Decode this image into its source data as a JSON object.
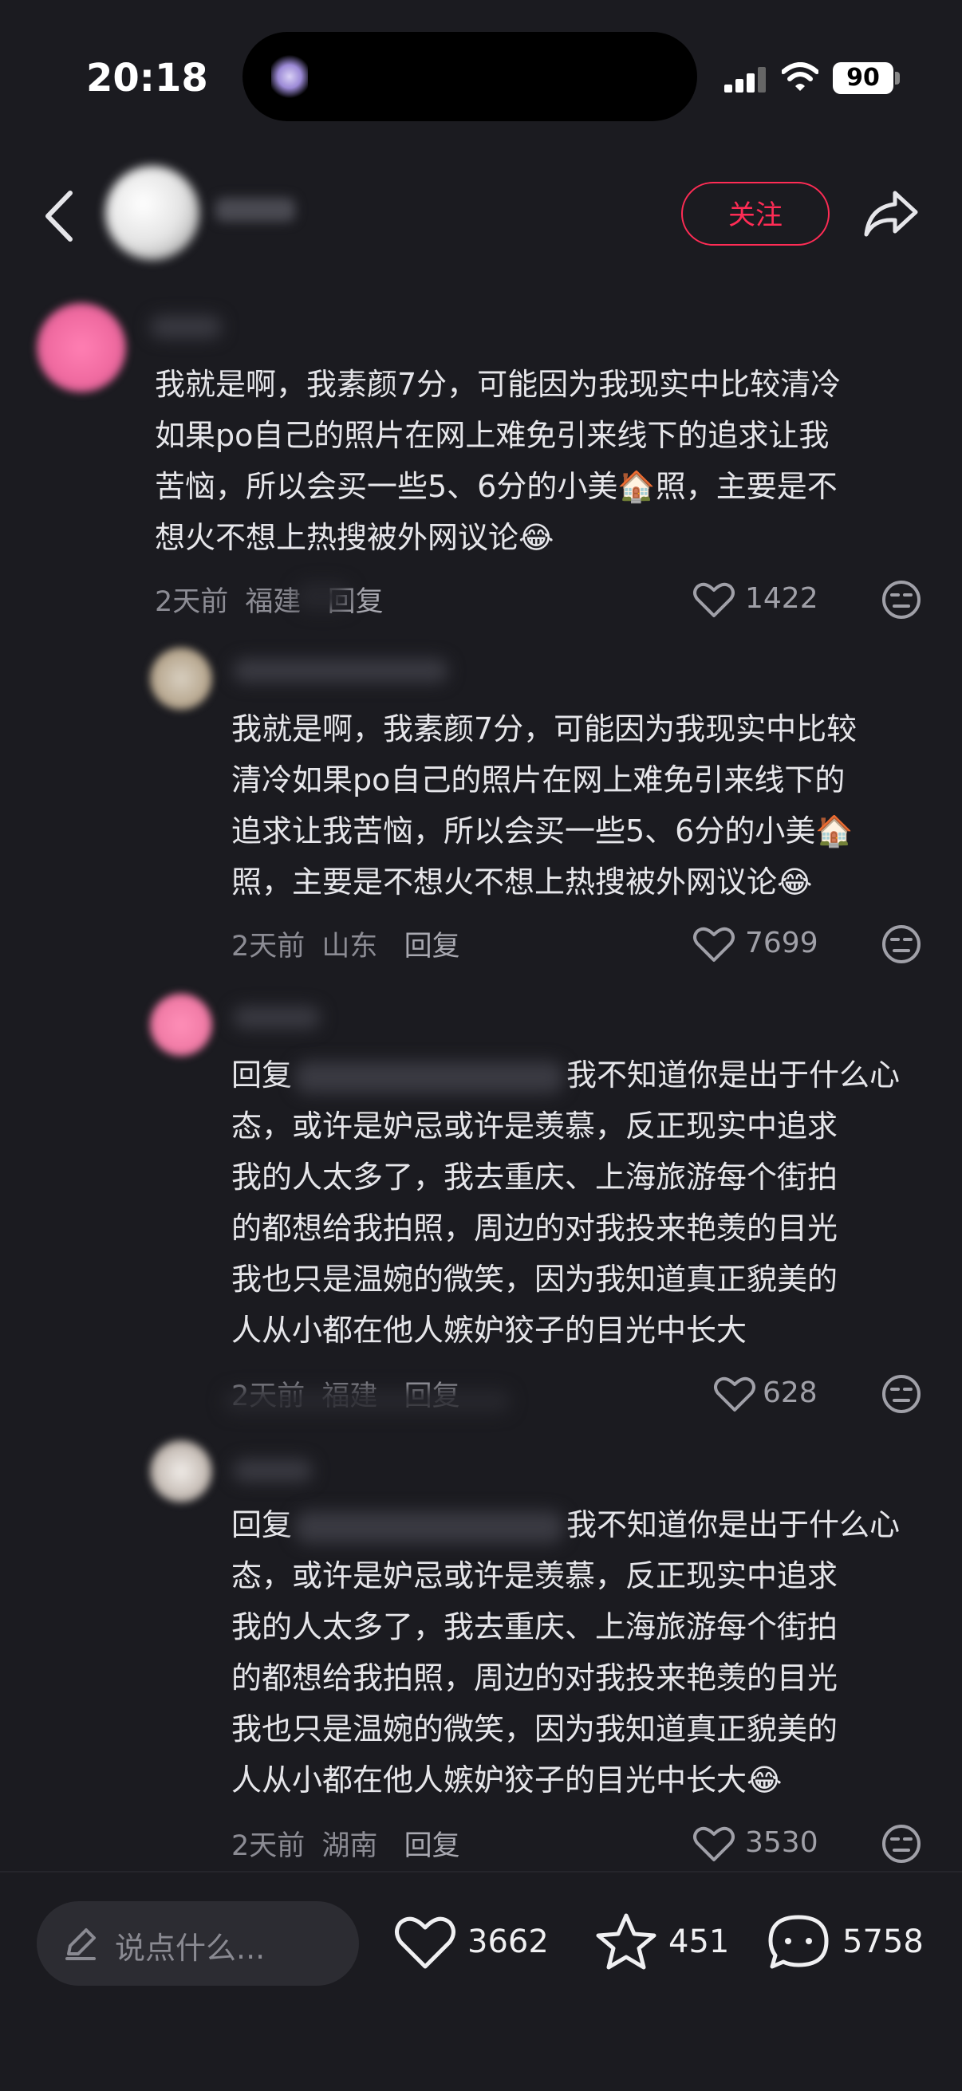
{
  "status": {
    "time": "20:18",
    "battery": "90"
  },
  "header": {
    "follow_label": "关注"
  },
  "comments": [
    {
      "text_a": "我就是啊，我素颜7分，可能因为我现实中比较清冷",
      "text_b": "如果po自己的照片在网上难免引来线下的追求让我",
      "text_c": "苦恼，所以会买一些5、6分的小美",
      "text_c2": "照，主要是不",
      "text_d": "想火不想上热搜被外网议论",
      "time": "2天前",
      "location": "福建",
      "reply_label": "回复",
      "likes": "1422"
    },
    {
      "text_a": "我就是啊，我素颜7分，可能因为我现实中比较",
      "text_b": "清冷如果po自己的照片在网上难免引来线下的",
      "text_c": "追求让我苦恼，所以会买一些5、6分的小美",
      "text_d": "照，主要是不想火不想上热搜被外网议论",
      "time": "2天前",
      "location": "山东",
      "reply_label": "回复",
      "likes": "7699"
    },
    {
      "reply_prefix": "回复",
      "text_a": "我不知道你是出于什么心",
      "text_b": "态，或许是妒忌或许是羡慕，反正现实中追求",
      "text_c": "我的人太多了，我去重庆、上海旅游每个街拍",
      "text_d": "的都想给我拍照，周边的对我投来艳羡的目光",
      "text_e": "我也只是温婉的微笑，因为我知道真正貌美的",
      "text_f": "人从小都在他人嫉妒狡子的目光中长大",
      "time": "2天前",
      "location": "福建",
      "reply_label": "回复",
      "likes": "628"
    },
    {
      "reply_prefix": "回复",
      "text_a": "我不知道你是出于什么心",
      "text_b": "态，或许是妒忌或许是羡慕，反正现实中追求",
      "text_c": "我的人太多了，我去重庆、上海旅游每个街拍",
      "text_d": "的都想给我拍照，周边的对我投来艳羡的目光",
      "text_e": "我也只是温婉的微笑，因为我知道真正貌美的",
      "text_f": "人从小都在他人嫉妒狡子的目光中长大",
      "time": "2天前",
      "location": "湖南",
      "reply_label": "回复",
      "likes": "3530"
    }
  ],
  "bottom": {
    "input_placeholder": "说点什么...",
    "likes": "3662",
    "favorites": "451",
    "comments": "5758"
  },
  "icons": {
    "house_emoji": "🏠",
    "crying_emoji": "😂"
  }
}
